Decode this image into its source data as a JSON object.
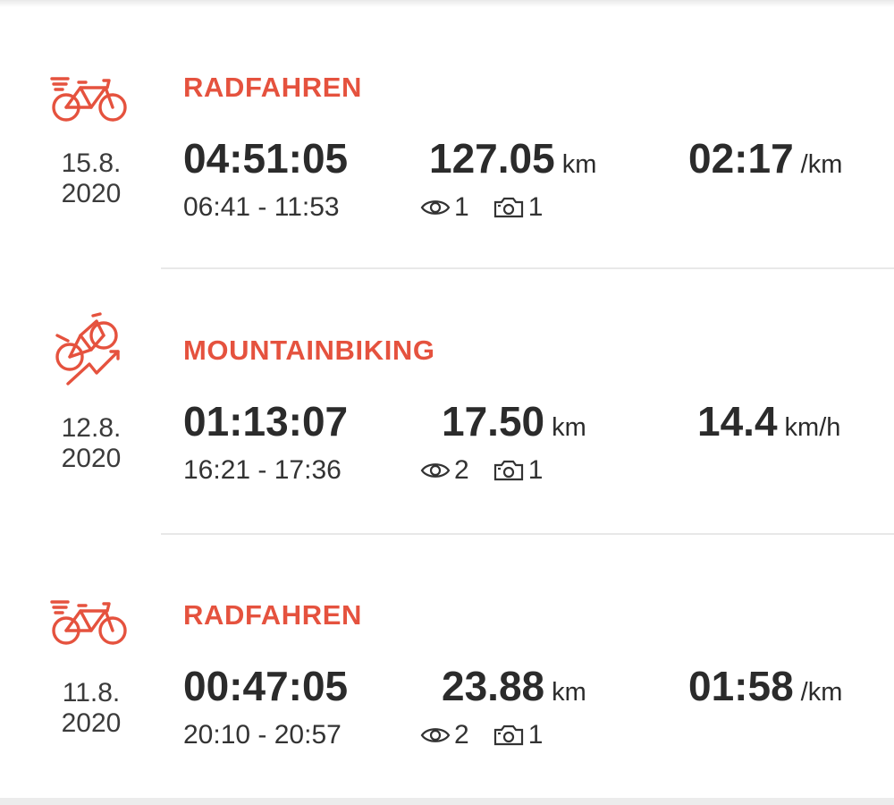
{
  "accent_color": "#e5523e",
  "activities": [
    {
      "icon": "road-bike-icon",
      "date_day": "15.8.",
      "date_year": "2020",
      "sport": "RADFAHREN",
      "duration": "04:51:05",
      "time_range": "06:41 - 11:53",
      "distance": "127.05",
      "distance_unit": "km",
      "pace": "02:17",
      "pace_unit": "/km",
      "views": "1",
      "photos": "1"
    },
    {
      "icon": "mountain-bike-icon",
      "date_day": "12.8.",
      "date_year": "2020",
      "sport": "MOUNTAINBIKING",
      "duration": "01:13:07",
      "time_range": "16:21 - 17:36",
      "distance": "17.50",
      "distance_unit": "km",
      "pace": "14.4",
      "pace_unit": "km/h",
      "views": "2",
      "photos": "1"
    },
    {
      "icon": "road-bike-icon",
      "date_day": "11.8.",
      "date_year": "2020",
      "sport": "RADFAHREN",
      "duration": "00:47:05",
      "time_range": "20:10 - 20:57",
      "distance": "23.88",
      "distance_unit": "km",
      "pace": "01:58",
      "pace_unit": "/km",
      "views": "2",
      "photos": "1"
    }
  ]
}
